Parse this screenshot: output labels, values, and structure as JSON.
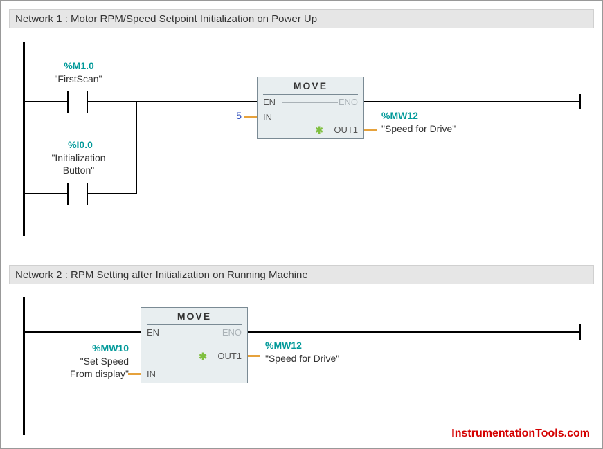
{
  "networks": {
    "n1": {
      "title": "Network 1 : Motor RPM/Speed Setpoint Initialization on Power Up"
    },
    "n2": {
      "title": "Network 2 : RPM Setting after Initialization on Running Machine"
    }
  },
  "contacts": {
    "first_scan": {
      "address": "%M1.0",
      "symbol": "\"FirstScan\""
    },
    "init_button": {
      "address": "%I0.0",
      "symbol": "\"Initialization\nButton\""
    }
  },
  "blocks": {
    "move1": {
      "title": "MOVE",
      "en": "EN",
      "eno": "ENO",
      "in_label": "IN",
      "out_label": "OUT1",
      "in_value": "5",
      "out_address": "%MW12",
      "out_symbol": "\"Speed for Drive\""
    },
    "move2": {
      "title": "MOVE",
      "en": "EN",
      "eno": "ENO",
      "in_label": "IN",
      "out_label": "OUT1",
      "in_address": "%MW10",
      "in_symbol": "\"Set Speed\nFrom display\"",
      "out_address": "%MW12",
      "out_symbol": "\"Speed for Drive\""
    }
  },
  "watermark": "InstrumentationTools.com"
}
